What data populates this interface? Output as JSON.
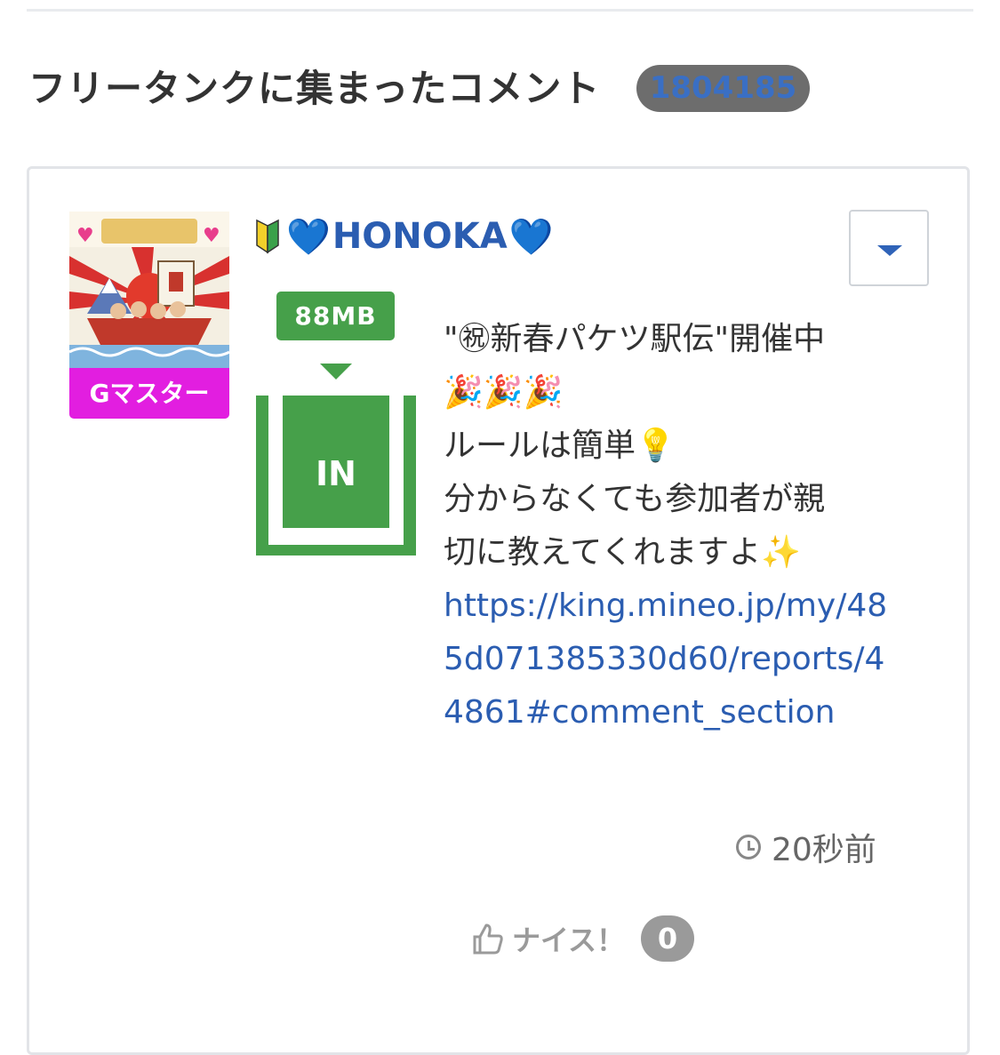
{
  "section": {
    "title": "フリータンクに集まったコメント",
    "count": "1804185"
  },
  "comment": {
    "rank": "Gマスター",
    "username_prefix_icon": "beginner-mark-icon",
    "username_emoji": "💙",
    "username": "HONOKA",
    "tank": {
      "mb": "88MB",
      "status": "IN"
    },
    "body_lines": [
      "\"㊗新春パケツ駅伝\"開催中",
      "🎉🎉🎉",
      "ルールは簡単💡",
      "分からなくても参加者が親",
      "切に教えてくれますよ✨"
    ],
    "link": "https://king.mineo.jp/my/485d071385330d60/reports/44861#comment_section",
    "timestamp": "20秒前",
    "nice_label": "ナイス！",
    "nice_count": "0"
  },
  "colors": {
    "accent_blue": "#2b5db1",
    "tank_green": "#46a04a",
    "rank_magenta": "#e21ee0",
    "badge_gray": "#6d6d6d"
  }
}
